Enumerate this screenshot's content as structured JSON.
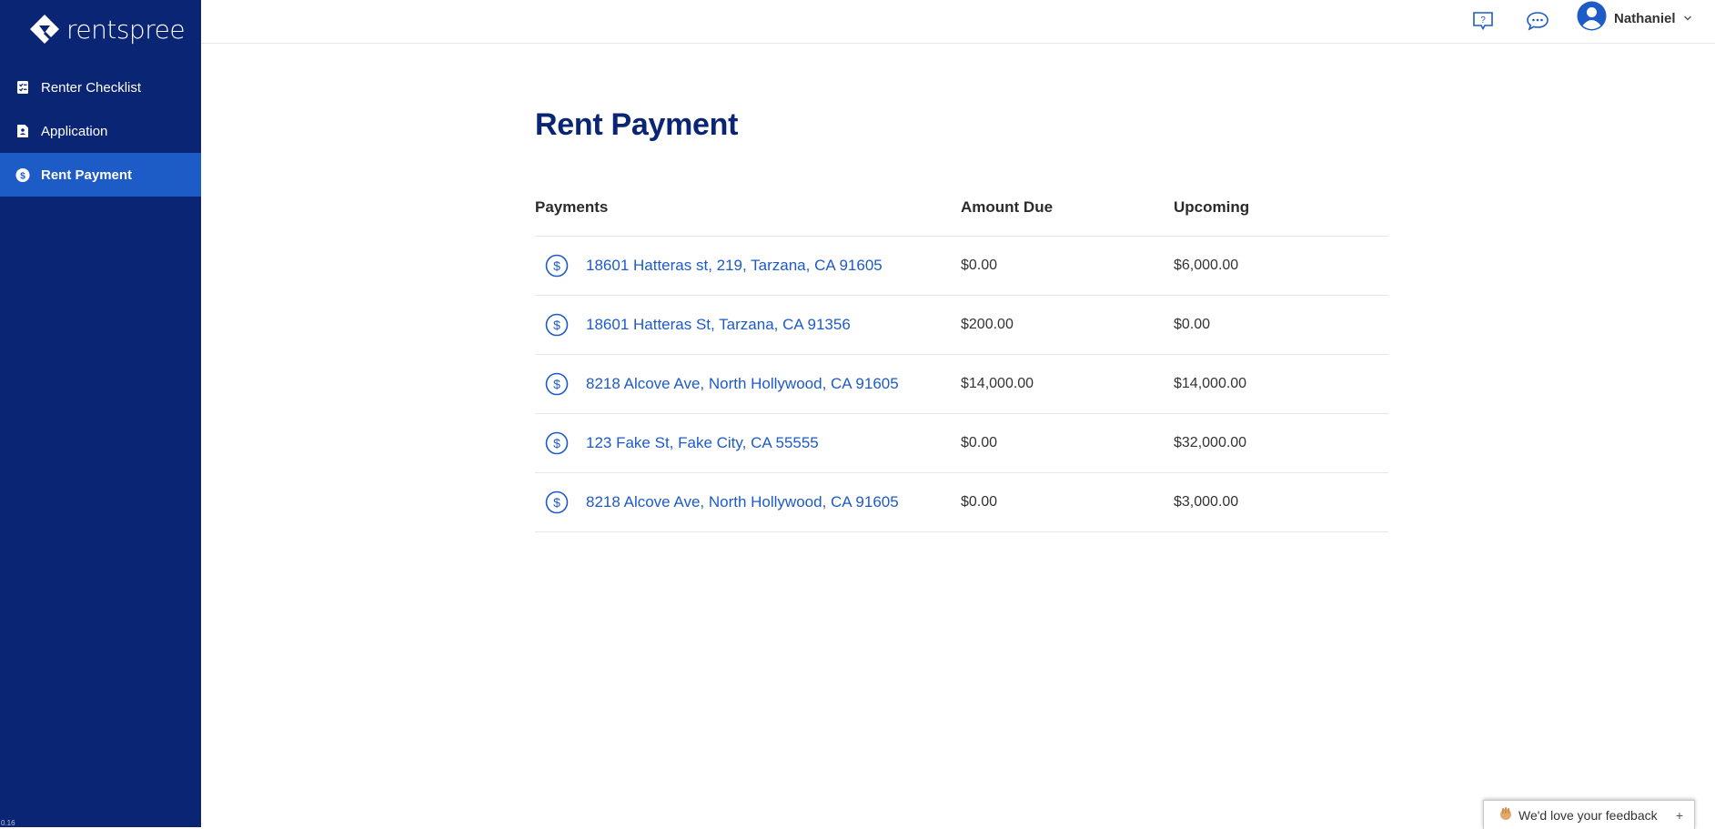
{
  "brand": {
    "name": "rentspree"
  },
  "sidebar": {
    "items": [
      {
        "label": "Renter Checklist",
        "icon": "checklist-icon"
      },
      {
        "label": "Application",
        "icon": "document-icon"
      },
      {
        "label": "Rent Payment",
        "icon": "dollar-icon",
        "active": true
      }
    ],
    "version": "0.16"
  },
  "topbar": {
    "help_icon": "help-icon",
    "chat_icon": "chat-icon",
    "user_name": "Nathaniel"
  },
  "page": {
    "title": "Rent Payment",
    "columns": [
      "Payments",
      "Amount Due",
      "Upcoming"
    ],
    "rows": [
      {
        "address": "18601 Hatteras st, 219, Tarzana, CA 91605",
        "amount_due": "$0.00",
        "upcoming": "$6,000.00"
      },
      {
        "address": "18601 Hatteras St, Tarzana, CA 91356",
        "amount_due": "$200.00",
        "upcoming": "$0.00"
      },
      {
        "address": "8218 Alcove Ave, North Hollywood, CA 91605",
        "amount_due": "$14,000.00",
        "upcoming": "$14,000.00"
      },
      {
        "address": "123 Fake St, Fake City, CA 55555",
        "amount_due": "$0.00",
        "upcoming": "$32,000.00"
      },
      {
        "address": "8218 Alcove Ave, North Hollywood, CA 91605",
        "amount_due": "$0.00",
        "upcoming": "$3,000.00"
      }
    ]
  },
  "feedback": {
    "label": "We'd love your feedback",
    "toggle": "+"
  },
  "colors": {
    "sidebar_bg": "#0b2575",
    "active_item_bg": "#1d5bc7",
    "title": "#0b2575",
    "link": "#1d5bc7"
  }
}
